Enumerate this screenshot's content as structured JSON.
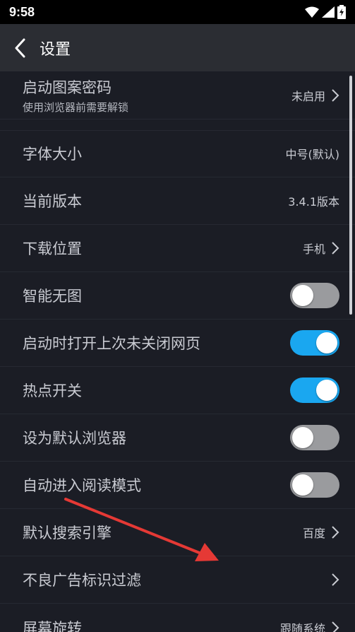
{
  "status": {
    "time": "9:58"
  },
  "header": {
    "title": "设置"
  },
  "settings": [
    {
      "label": "启动图案密码",
      "sub": "使用浏览器前需要解锁",
      "value": "未启用"
    },
    {
      "label": "字体大小",
      "value": "中号(默认)"
    },
    {
      "label": "当前版本",
      "value": "3.4.1版本"
    },
    {
      "label": "下载位置",
      "value": "手机"
    },
    {
      "label": "智能无图",
      "toggle": false
    },
    {
      "label": "启动时打开上次未关闭网页",
      "toggle": true
    },
    {
      "label": "热点开关",
      "toggle": true
    },
    {
      "label": "设为默认浏览器",
      "toggle": false
    },
    {
      "label": "自动进入阅读模式",
      "toggle": false
    },
    {
      "label": "默认搜索引擎",
      "value": "百度"
    },
    {
      "label": "不良广告标识过滤"
    },
    {
      "label": "屏幕旋转",
      "value": "跟随系统"
    }
  ],
  "colors": {
    "toggle_on": "#1aa7f0",
    "toggle_off": "#9a9b9e",
    "annotation_arrow": "#e53935"
  }
}
